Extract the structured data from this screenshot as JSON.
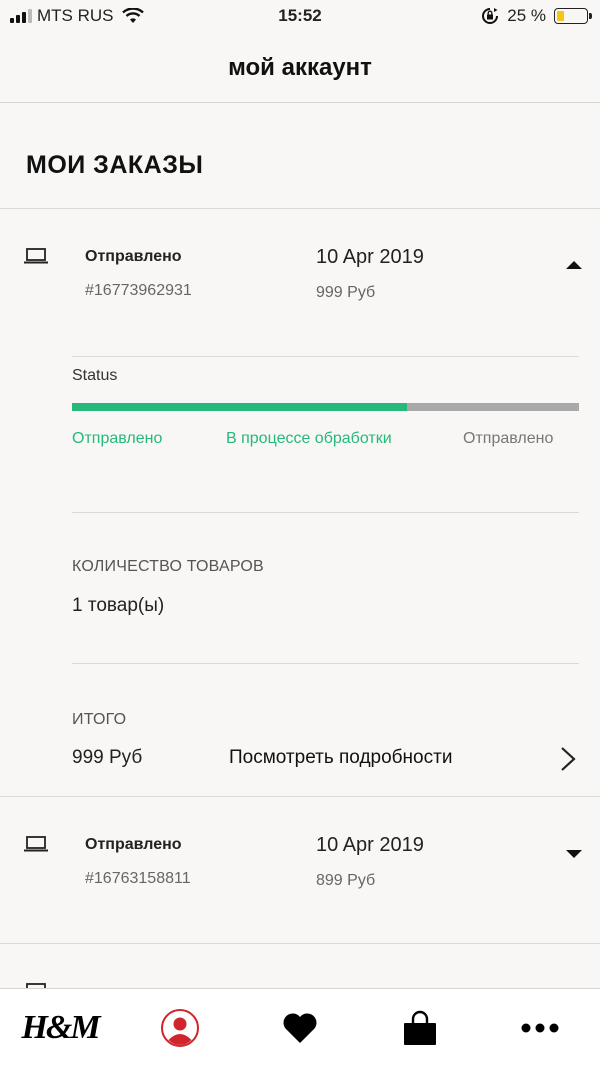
{
  "status_bar": {
    "carrier": "MTS RUS",
    "time": "15:52",
    "battery": "25 %",
    "battery_level": 0.25
  },
  "header": {
    "title": "мой аккаунт"
  },
  "section_title": "МОИ ЗАКАЗЫ",
  "orders": [
    {
      "status": "Отправлено",
      "number": "#16773962931",
      "date": "10 Apr 2019",
      "price": "999 Руб",
      "expanded": true,
      "details": {
        "status_label": "Status",
        "progress_fraction": 0.66,
        "steps": [
          "Отправлено",
          "В процессе обработки",
          "Отправлено"
        ],
        "quantity_label": "КОЛИЧЕСТВО ТОВАРОВ",
        "quantity": "1 товар(ы)",
        "total_label": "ИТОГО",
        "total": "999 Руб",
        "details_link": "Посмотреть подробности"
      }
    },
    {
      "status": "Отправлено",
      "number": "#16763158811",
      "date": "10 Apr 2019",
      "price": "899 Руб",
      "expanded": false
    }
  ],
  "tab_bar": {
    "items": [
      {
        "name": "home",
        "label": "H&M",
        "icon": "hm-logo"
      },
      {
        "name": "account",
        "icon": "profile-icon",
        "active": true
      },
      {
        "name": "favourites",
        "icon": "heart-icon"
      },
      {
        "name": "bag",
        "icon": "shopping-bag-icon"
      },
      {
        "name": "more",
        "icon": "more-icon"
      }
    ]
  },
  "colors": {
    "accent": "#26b97b",
    "profile": "#d0252c",
    "progress_bg": "#a9a9a9"
  }
}
